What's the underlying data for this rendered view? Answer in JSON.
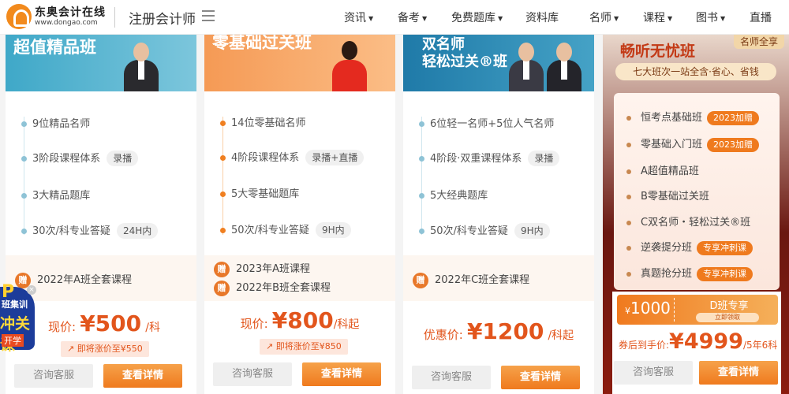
{
  "header": {
    "brand": "东奥会计在线",
    "brand_url": "www.dongao.com",
    "site_title": "注册会计师",
    "nav": [
      "资讯",
      "备考",
      "免费题库",
      "资料库",
      "名师",
      "课程",
      "图书",
      "直播"
    ]
  },
  "cards": [
    {
      "title": "超值精品班",
      "features": [
        {
          "text": "9位精品名师",
          "tag": ""
        },
        {
          "text": "3阶段课程体系",
          "tag": "录播"
        },
        {
          "text": "3大精品题库",
          "tag": ""
        },
        {
          "text": "30次/科专业答疑",
          "tag": "24H内"
        }
      ],
      "gifts": [
        "2022年A班全套课程"
      ],
      "price_label": "现价:",
      "price": "¥500",
      "price_unit": "/科",
      "rise": "即将涨价至¥550",
      "btn_consult": "咨询客服",
      "btn_detail": "查看详情"
    },
    {
      "title": "零基础过关班",
      "features": [
        {
          "text": "14位零基础名师",
          "tag": ""
        },
        {
          "text": "4阶段课程体系",
          "tag": "录播+直播"
        },
        {
          "text": "5大零基础题库",
          "tag": ""
        },
        {
          "text": "50次/科专业答疑",
          "tag": "9H内"
        }
      ],
      "gifts": [
        "2023年A班课程",
        "2022年B班全套课程"
      ],
      "price_label": "现价:",
      "price": "¥800",
      "price_unit": "/科起",
      "rise": "即将涨价至¥850",
      "btn_consult": "咨询客服",
      "btn_detail": "查看详情"
    },
    {
      "title_line1": "双名师",
      "title_line2": "轻松过关®班",
      "features": [
        {
          "text": "6位轻一名师+5位人气名师",
          "tag": ""
        },
        {
          "text": "4阶段·双重课程体系",
          "tag": "录播"
        },
        {
          "text": "5大经典题库",
          "tag": ""
        },
        {
          "text": "50次/科专业答疑",
          "tag": "9H内"
        }
      ],
      "gifts": [
        "2022年C班全套课程"
      ],
      "price_label": "优惠价:",
      "price": "¥1200",
      "price_unit": "/科起",
      "btn_consult": "咨询客服",
      "btn_detail": "查看详情"
    }
  ],
  "card4": {
    "title": "畅听无忧班",
    "badge": "名师全享",
    "subtitle": "七大班次一站全含·省心、省钱",
    "items": [
      {
        "text": "恒考点基础班",
        "tag": "2023加赠"
      },
      {
        "text": "零基础入门班",
        "tag": "2023加赠"
      },
      {
        "text": "A超值精品班",
        "tag": ""
      },
      {
        "text": "B零基础过关班",
        "tag": ""
      },
      {
        "text": "C双名师・轻松过关®班",
        "tag": ""
      },
      {
        "text": "逆袭提分班",
        "tag": "专享冲刺课"
      },
      {
        "text": "真题抢分班",
        "tag": "专享冲刺课"
      }
    ],
    "coupon_currency": "¥",
    "coupon_value": "1000",
    "coupon_name": "D班专享",
    "coupon_btn": "立即领取",
    "price_label": "券后到手价:",
    "price": "¥4999",
    "price_unit": "/5年6科",
    "btn_consult": "咨询客服",
    "btn_detail": "查看详情"
  },
  "promo": {
    "letter": "P",
    "line1": "班集训",
    "line2": "冲关课",
    "line3": "开学"
  },
  "gift_icon_label": "赠",
  "colors": {
    "accent": "#ef7a1e",
    "price": "#e2551c",
    "card1_dot": "#8ec3d6",
    "card2_dot": "#f07f20",
    "card3_dot": "#8ec3d6"
  }
}
